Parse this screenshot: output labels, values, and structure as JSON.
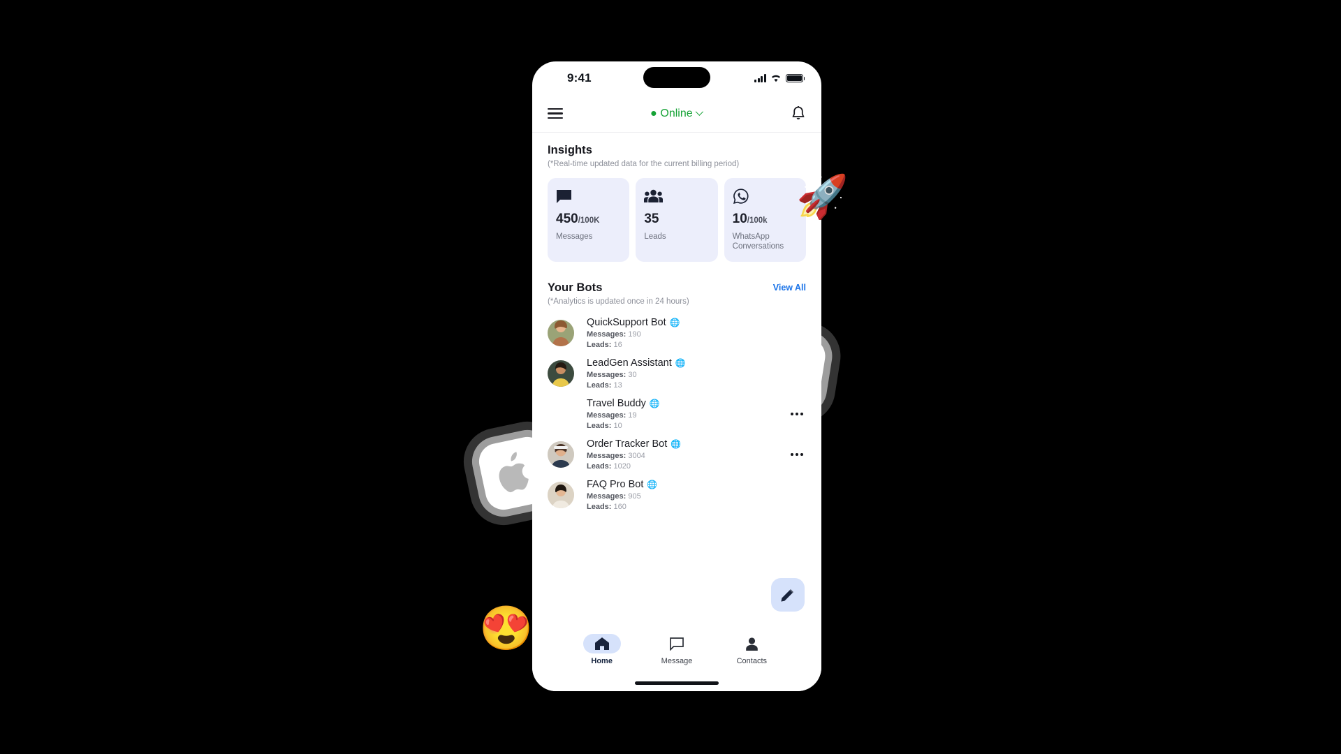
{
  "statusbar": {
    "time": "9:41",
    "signal_icon": "cellular-signal-icon",
    "wifi_icon": "wifi-icon",
    "battery_icon": "battery-icon"
  },
  "appbar": {
    "menu_icon": "hamburger-menu-icon",
    "status_label": "Online",
    "status_color": "#16a336",
    "chevron_icon": "chevron-down-icon",
    "bell_icon": "notification-bell-icon"
  },
  "insights": {
    "title": "Insights",
    "subtitle": "(*Real-time updated data for the current billing period)",
    "cards": [
      {
        "icon": "chat-bubble-icon",
        "value": "450",
        "unit": "/100K",
        "label": "Messages"
      },
      {
        "icon": "people-group-icon",
        "value": "35",
        "unit": "",
        "label": "Leads"
      },
      {
        "icon": "whatsapp-icon",
        "value": "10",
        "unit": "/100k",
        "label": "WhatsApp Conversations"
      }
    ]
  },
  "bots": {
    "title": "Your Bots",
    "subtitle": "(*Analytics is updated once in 24 hours)",
    "view_all_label": "View All",
    "view_all_color": "#1a73e8",
    "messages_label": "Messages:",
    "leads_label": "Leads:",
    "channel_icon": "globe-icon",
    "menu_icon": "kebab-menu-icon",
    "items": [
      {
        "name": "QuickSupport Bot",
        "messages": "190",
        "leads": "16",
        "avatar": "avatar-woman-outdoors",
        "menu_visible": false
      },
      {
        "name": "LeadGen Assistant",
        "messages": "30",
        "leads": "13",
        "avatar": "avatar-woman-yellow",
        "menu_visible": false
      },
      {
        "name": "Travel Buddy",
        "messages": "19",
        "leads": "10",
        "avatar": "avatar-hidden",
        "menu_visible": true
      },
      {
        "name": "Order Tracker Bot",
        "messages": "3004",
        "leads": "1020",
        "avatar": "avatar-woman-headband",
        "menu_visible": true
      },
      {
        "name": "FAQ Pro Bot",
        "messages": "905",
        "leads": "160",
        "avatar": "avatar-woman-smiling",
        "menu_visible": false
      }
    ]
  },
  "fab": {
    "icon": "pencil-edit-icon",
    "background": "#d6e2fb"
  },
  "bottom_nav": {
    "items": [
      {
        "label": "Home",
        "icon": "home-icon",
        "active": true
      },
      {
        "label": "Message",
        "icon": "chat-bubble-icon",
        "active": false
      },
      {
        "label": "Contacts",
        "icon": "person-icon",
        "active": false
      }
    ],
    "active_pill_color": "#d6e2fb"
  },
  "decorations": [
    {
      "name": "rocket-emoji",
      "glyph": "🚀"
    },
    {
      "name": "heart-eyes-emoji",
      "glyph": "😍"
    },
    {
      "name": "android-logo-tile",
      "color": "#3ddc84"
    },
    {
      "name": "apple-logo-tile",
      "color": "#b9b9b9"
    }
  ]
}
